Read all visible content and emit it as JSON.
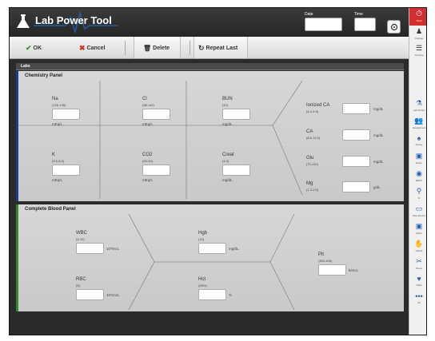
{
  "header": {
    "title": "Lab Power Tool",
    "date_label": "Date",
    "time_label": "Time",
    "date_value": "",
    "time_value": ""
  },
  "toolbar": {
    "ok_label": "OK",
    "cancel_label": "Cancel",
    "delete_label": "Delete",
    "repeat_label": "Repeat Last"
  },
  "labs": {
    "label": "Labs"
  },
  "chem": {
    "title": "Chemistry Panel",
    "na": {
      "name": "Na",
      "range": "(135-145)",
      "unit": "mEq/L",
      "value": ""
    },
    "cl": {
      "name": "Cl",
      "range": "(98-110)",
      "unit": "mEq/L",
      "value": ""
    },
    "bun": {
      "name": "BUN",
      "range": "(10)",
      "unit": "mg/dL",
      "value": ""
    },
    "k": {
      "name": "K",
      "range": "(3.5-5.0)",
      "unit": "mEq/L",
      "value": ""
    },
    "co2": {
      "name": "CO2",
      "range": "(20-30)",
      "unit": "mEq/L",
      "value": ""
    },
    "creat": {
      "name": "Creat",
      "range": "(1.0)",
      "unit": "mg/dL",
      "value": ""
    },
    "ica": {
      "name": "Ionized CA",
      "range": "(4.4-4.8)",
      "unit": "mg/dL",
      "value": ""
    },
    "ca": {
      "name": "CA",
      "range": "(8.6-11.0)",
      "unit": "mg/dL",
      "value": ""
    },
    "glu": {
      "name": "Glu",
      "range": "(70-110)",
      "unit": "mg/dL",
      "value": ""
    },
    "mg": {
      "name": "Mg",
      "range": "(1.3-2.0)",
      "unit": "g/dL",
      "value": ""
    }
  },
  "cbc": {
    "title": "Complete Blood Panel",
    "wbc": {
      "name": "WBC",
      "range": "(4-10)",
      "unit": "10³/mcL",
      "value": ""
    },
    "hgb": {
      "name": "Hgb",
      "range": "(15)",
      "unit": "mg/dL",
      "value": ""
    },
    "plt": {
      "name": "Plt",
      "range": "(300-400)",
      "unit": "k/mcL",
      "value": ""
    },
    "rbc": {
      "name": "RBC",
      "range": "(5)",
      "unit": "10⁶/mcL",
      "value": ""
    },
    "hct": {
      "name": "Hct",
      "range": "(45%)",
      "unit": "%",
      "value": ""
    }
  },
  "rail": {
    "items": [
      {
        "label": "Timer",
        "icon": "clock-icon"
      },
      {
        "label": "Change",
        "icon": "person-icon"
      },
      {
        "label": "Timeline",
        "icon": "timeline-icon"
      },
      {
        "label": "Lab Power",
        "icon": "flask-icon"
      },
      {
        "label": "Assessment",
        "icon": "people-icon"
      },
      {
        "label": "Airway",
        "icon": "lungs-icon"
      },
      {
        "label": "Exam",
        "icon": "kit-icon"
      },
      {
        "label": "EENT",
        "icon": "eye-icon"
      },
      {
        "label": "IV",
        "icon": "iv-icon"
      },
      {
        "label": "Med Device",
        "icon": "monitor-icon"
      },
      {
        "label": "Meds",
        "icon": "kit-icon"
      },
      {
        "label": "Hybrid",
        "icon": "hand-icon"
      },
      {
        "label": "Procs",
        "icon": "scissors-icon"
      },
      {
        "label": "Vitals",
        "icon": "vitals-icon"
      },
      {
        "label": "All",
        "icon": "more-icon"
      }
    ]
  },
  "colors": {
    "chem_accent": "#1f3b8f",
    "cbc_accent": "#2e8b2e",
    "ok_green": "#3a9a2a",
    "cancel_red": "#d32f2f",
    "rail_active": "#d32f2f",
    "icon_blue": "#2b5fb3"
  }
}
